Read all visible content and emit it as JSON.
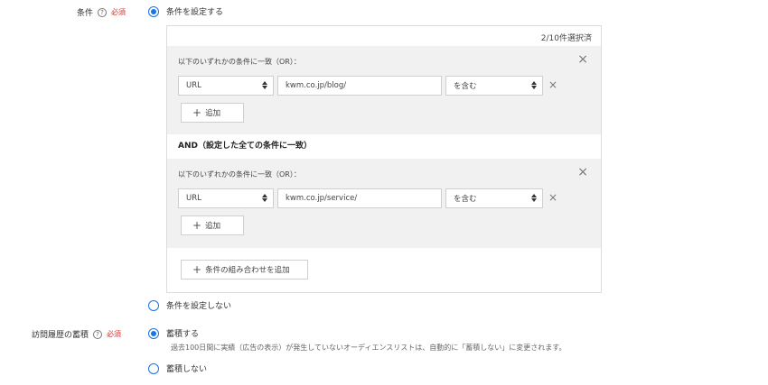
{
  "condition": {
    "label": "条件",
    "help_icon": "?",
    "required": "必須",
    "set_option": "条件を設定する",
    "counter": "2/10件選択済",
    "groups": [
      {
        "title": "以下のいずれかの条件に一致（OR）：",
        "type_value": "URL",
        "value": "kwm.co.jp/blog/",
        "operator": "を含む",
        "add_label": "追加"
      },
      {
        "title": "以下のいずれかの条件に一致（OR）：",
        "type_value": "URL",
        "value": "kwm.co.jp/service/",
        "operator": "を含む",
        "add_label": "追加"
      }
    ],
    "and_label": "AND（設定した全ての条件に一致）",
    "add_combo_label": "条件の組み合わせを追加",
    "unset_option": "条件を設定しない"
  },
  "accumulation": {
    "label": "訪問履歴の蓄積",
    "help_icon": "?",
    "required": "必須",
    "on_option": "蓄積する",
    "note": "過去100日間に実績（広告の表示）が発生していないオーディエンスリストは、自動的に「蓄積しない」に変更されます。",
    "off_option": "蓄積しない"
  },
  "icons": {
    "close": "×",
    "plus": "+",
    "help": "question-circle"
  }
}
